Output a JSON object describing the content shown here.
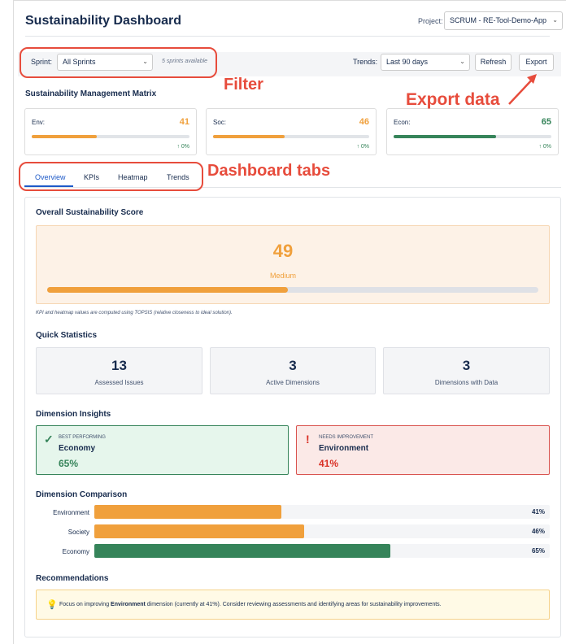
{
  "header": {
    "title": "Sustainability Dashboard",
    "project_label": "Project:",
    "project_value": "SCRUM - RE-Tool-Demo-App"
  },
  "filters": {
    "sprint_label": "Sprint:",
    "sprint_value": "All Sprints",
    "sprints_available": "5 sprints available",
    "trends_label": "Trends:",
    "trends_value": "Last 90 days",
    "refresh_label": "Refresh",
    "export_label": "Export"
  },
  "annotations": {
    "filter": "Filter",
    "export_data": "Export data",
    "dashboard_tabs": "Dashboard tabs",
    "color": "#e74c3c"
  },
  "matrix": {
    "title": "Sustainability Management Matrix",
    "cards": [
      {
        "label": "Env:",
        "value": "41",
        "percent": 41,
        "trend": "↑ 0%",
        "color": "#f0a03c"
      },
      {
        "label": "Soc:",
        "value": "46",
        "percent": 46,
        "trend": "↑ 0%",
        "color": "#f0a03c"
      },
      {
        "label": "Econ:",
        "value": "65",
        "percent": 65,
        "trend": "↑ 0%",
        "color": "#36845a"
      }
    ]
  },
  "tabs": [
    {
      "label": "Overview",
      "active": true
    },
    {
      "label": "KPIs",
      "active": false
    },
    {
      "label": "Heatmap",
      "active": false
    },
    {
      "label": "Trends",
      "active": false
    }
  ],
  "overall": {
    "title": "Overall Sustainability Score",
    "score": "49",
    "percent": 49,
    "level": "Medium",
    "note": "KPI and heatmap values are computed using TOPSIS (relative closeness to ideal solution)."
  },
  "quick_stats": {
    "title": "Quick Statistics",
    "items": [
      {
        "value": "13",
        "label": "Assessed Issues"
      },
      {
        "value": "3",
        "label": "Active Dimensions"
      },
      {
        "value": "3",
        "label": "Dimensions with Data"
      }
    ]
  },
  "insights": {
    "title": "Dimension Insights",
    "best": {
      "caption": "BEST PERFORMING",
      "name": "Economy",
      "value": "65%",
      "icon": "check-icon"
    },
    "worst": {
      "caption": "NEEDS IMPROVEMENT",
      "name": "Environment",
      "value": "41%",
      "icon": "exclamation-icon"
    }
  },
  "comparison": {
    "title": "Dimension Comparison",
    "rows": [
      {
        "label": "Environment",
        "value": "41%",
        "percent": 41,
        "color": "#f0a03c"
      },
      {
        "label": "Society",
        "value": "46%",
        "percent": 46,
        "color": "#f0a03c"
      },
      {
        "label": "Economy",
        "value": "65%",
        "percent": 65,
        "color": "#36845a"
      }
    ]
  },
  "recommendations": {
    "title": "Recommendations",
    "text_pre": "Focus on improving ",
    "text_bold": "Environment",
    "text_post": " dimension (currently at 41%). Consider reviewing assessments and identifying areas for sustainability improvements.",
    "icon": "lightbulb-icon"
  }
}
